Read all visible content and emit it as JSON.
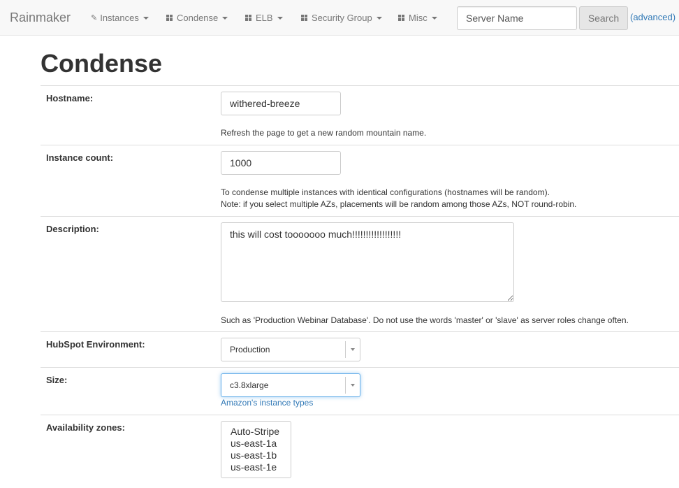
{
  "navbar": {
    "brand": "Rainmaker",
    "items": [
      {
        "label": "Instances",
        "icon": "pencil-icon"
      },
      {
        "label": "Condense",
        "icon": "grid-icon"
      },
      {
        "label": "ELB",
        "icon": "grid-icon"
      },
      {
        "label": "Security Group",
        "icon": "grid-icon"
      },
      {
        "label": "Misc",
        "icon": "grid-icon"
      }
    ],
    "search": {
      "placeholder": "Server Name",
      "value": "",
      "button": "Search"
    },
    "advanced_link": "(advanced)"
  },
  "page": {
    "title": "Condense",
    "hostname": {
      "label": "Hostname:",
      "value": "withered-breeze",
      "help": "Refresh the page to get a new random mountain name."
    },
    "instance_count": {
      "label": "Instance count:",
      "value": "1000",
      "help_line1": "To condense multiple instances with identical configurations (hostnames will be random).",
      "help_line2": "Note: if you select multiple AZs, placements will be random among those AZs, NOT round-robin."
    },
    "description": {
      "label": "Description:",
      "value": "this will cost tooooooo much!!!!!!!!!!!!!!!!!!",
      "help": "Such as 'Production Webinar Database'. Do not use the words 'master' or 'slave' as server roles change often."
    },
    "environment": {
      "label": "HubSpot Environment:",
      "selected": "Production"
    },
    "size": {
      "label": "Size:",
      "selected": "c3.8xlarge",
      "link": "Amazon's instance types"
    },
    "availability_zones": {
      "label": "Availability zones:",
      "options": [
        "Auto-Stripe",
        "us-east-1a",
        "us-east-1b",
        "us-east-1e"
      ]
    }
  },
  "colors": {
    "navbar_bg": "#f8f8f8",
    "link": "#337ab7",
    "focus": "#66afe9"
  }
}
